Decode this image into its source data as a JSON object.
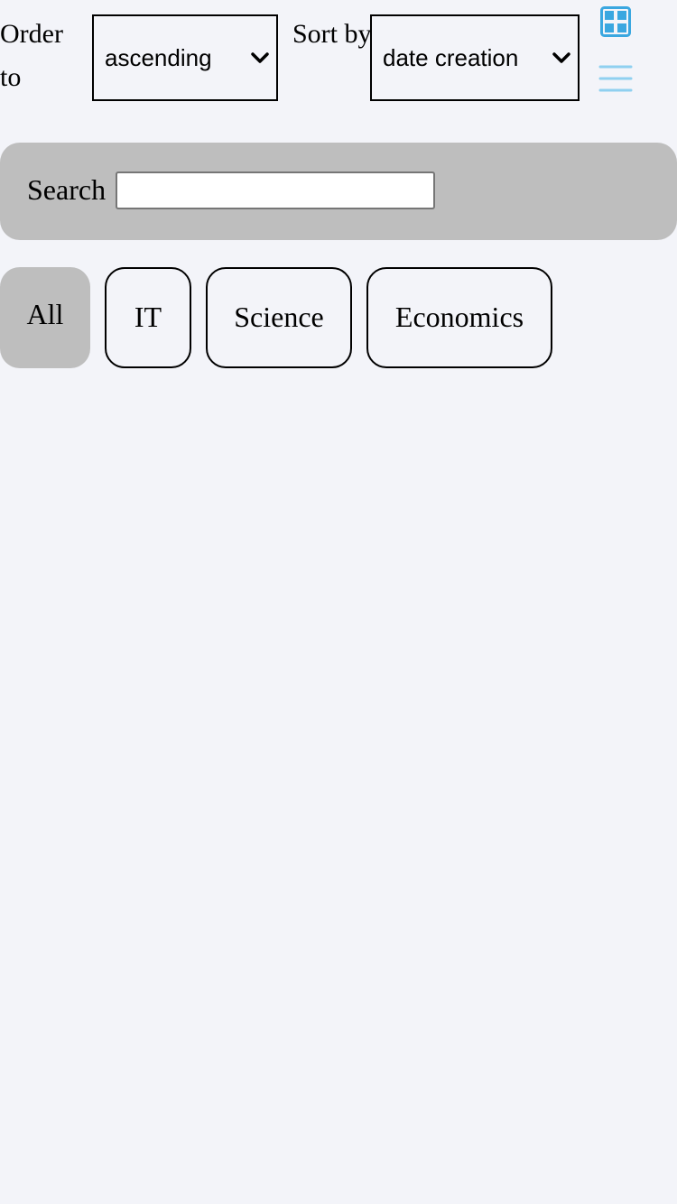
{
  "toolbar": {
    "order_label": "Order to",
    "order_value": "ascending",
    "sort_label": "Sort by",
    "sort_value": "date creation",
    "grid_view_icon": "grid-icon",
    "list_view_icon": "list-icon",
    "icon_colors": {
      "grid": "#3aa7e0",
      "list": "#8fd0f0"
    }
  },
  "search": {
    "label": "Search",
    "value": "",
    "placeholder": ""
  },
  "filters": {
    "items": [
      {
        "label": "All",
        "active": true
      },
      {
        "label": "IT",
        "active": false
      },
      {
        "label": "Science",
        "active": false
      },
      {
        "label": "Economics",
        "active": false
      }
    ],
    "active_color": "#bebebe"
  },
  "page": {
    "background": "#f3f4f9"
  }
}
